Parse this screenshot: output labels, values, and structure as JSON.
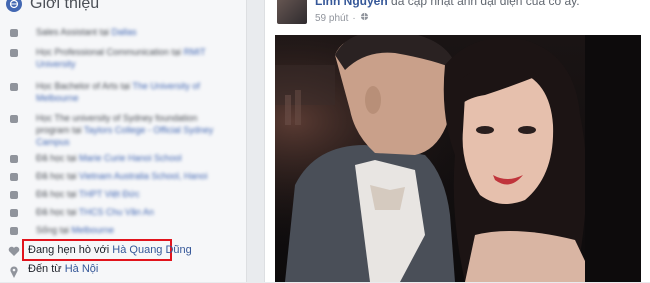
{
  "intro": {
    "title": "Giới thiệu",
    "items": [
      {
        "text": "Sales Assistant tại ",
        "link": "Dallas"
      },
      {
        "text": "Học Professional Communication tại ",
        "link": "RMIT University"
      },
      {
        "text": "Học Bachelor of Arts tại ",
        "link": "The University of Melbourne"
      },
      {
        "text": "Học The university of Sydney foundation program tại ",
        "link": "Taylors College - Official Sydney Campus"
      },
      {
        "text": "Đã học tại ",
        "link": "Marie Curie Hanoi School"
      },
      {
        "text": "Đã học tại ",
        "link": "Vietnam Australia School, Hanoi"
      },
      {
        "text": "Đã học tại ",
        "link": "THPT Việt Đức"
      },
      {
        "text": "Đã học tại ",
        "link": "THCS Chu Văn An"
      },
      {
        "text": "Sống tại ",
        "link": "Melbourne"
      }
    ],
    "relationship": {
      "prefix": "Đang hẹn hò với",
      "name": "Hà Quang Dũng"
    },
    "hometown": {
      "prefix": "Đến từ",
      "place": "Hà Nội"
    }
  },
  "post": {
    "author": "Linh Nguyen",
    "action": "đã cập nhật ảnh đại diện của cô ấy.",
    "time": "59 phút",
    "separator": "·"
  },
  "colors": {
    "highlight": "#e1141d",
    "link": "#365899",
    "brand": "#4267b2"
  }
}
